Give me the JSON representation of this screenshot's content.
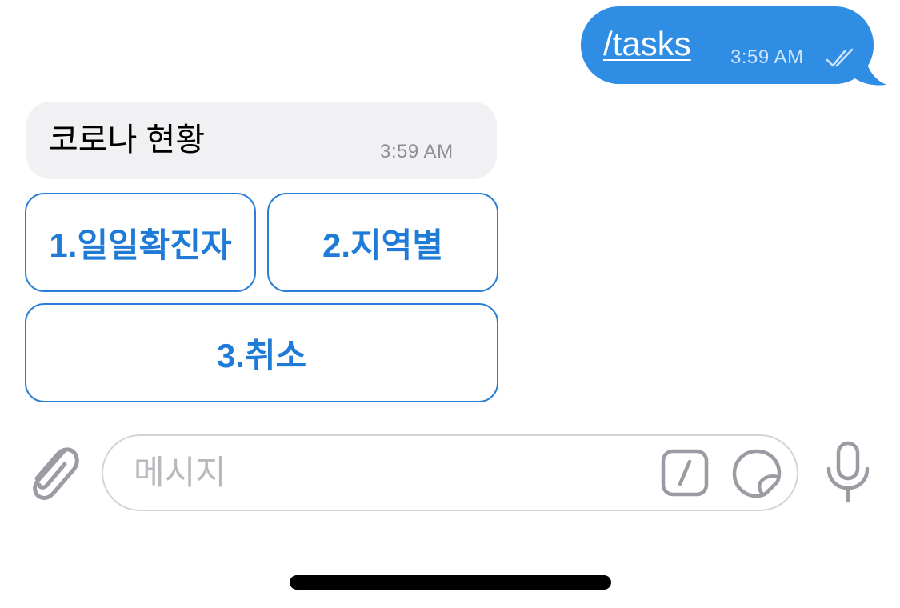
{
  "outgoing_message": {
    "text": "/tasks",
    "time": "3:59 AM",
    "status_icon": "double-check-icon"
  },
  "incoming_message": {
    "text": "코로나 현황",
    "time": "3:59 AM"
  },
  "inline_keyboard": {
    "buttons": [
      {
        "label": "1.일일확진자"
      },
      {
        "label": "2.지역별"
      },
      {
        "label": "3.취소"
      }
    ]
  },
  "composer": {
    "placeholder": "메시지",
    "attach_icon": "paperclip-icon",
    "command_icon": "slash-command-icon",
    "sticker_icon": "sticker-icon",
    "mic_icon": "microphone-icon"
  },
  "colors": {
    "outgoing_bubble": "#2f8de4",
    "incoming_bubble": "#f1f1f4",
    "button_accent": "#1f7bd6",
    "icon_gray": "#9b9ba3"
  }
}
